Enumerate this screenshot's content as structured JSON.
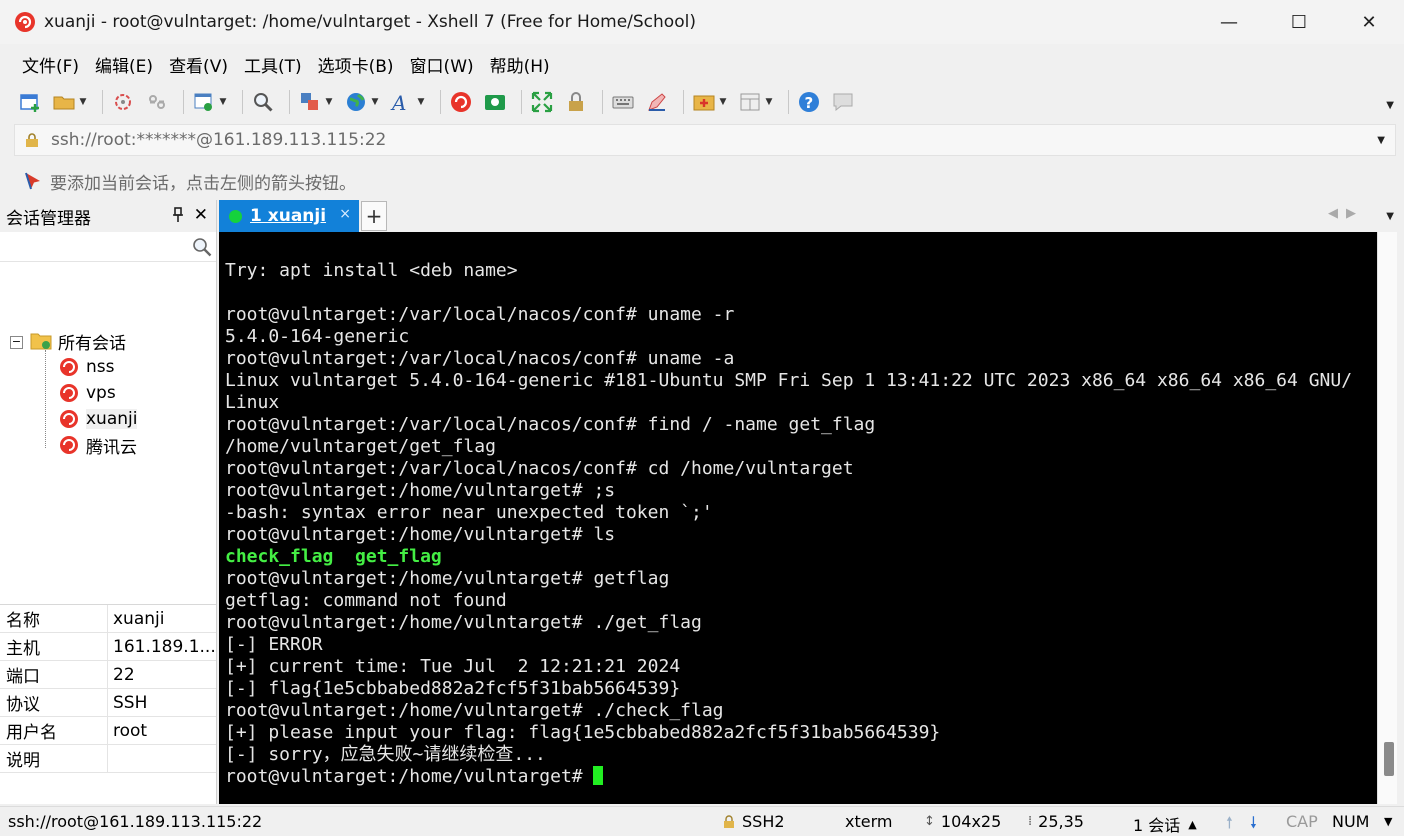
{
  "window": {
    "title": "xuanji - root@vulntarget: /home/vulntarget - Xshell 7 (Free for Home/School)",
    "minimize": "—",
    "maximize": "☐",
    "close": "✕"
  },
  "menu": [
    "文件(F)",
    "编辑(E)",
    "查看(V)",
    "工具(T)",
    "选项卡(B)",
    "窗口(W)",
    "帮助(H)"
  ],
  "toolbar": {
    "icons": [
      "new-session-icon",
      "open-folder-icon",
      "reconnect-icon",
      "disconnect-icon",
      "properties-icon",
      "find-icon",
      "transfer-icon",
      "globe-icon",
      "font-icon",
      "xshell-icon",
      "xftp-icon",
      "fullscreen-icon",
      "lock-icon",
      "keyboard-icon",
      "highlight-icon",
      "add-tab-icon",
      "layout-icon",
      "help-icon",
      "chat-icon"
    ]
  },
  "address": {
    "value": "ssh://root:*******@161.189.113.115:22"
  },
  "hint": {
    "text": "要添加当前会话，点击左侧的箭头按钮。"
  },
  "session_manager": {
    "title": "会话管理器",
    "pin": "📌",
    "close": "✕",
    "search_placeholder": "",
    "root_folder": "所有会话",
    "toggle": "−",
    "sessions": [
      "nss",
      "vps",
      "xuanji",
      "腾讯云"
    ],
    "selected": "xuanji",
    "properties": [
      {
        "key": "名称",
        "value": "xuanji"
      },
      {
        "key": "主机",
        "value": "161.189.1..."
      },
      {
        "key": "端口",
        "value": "22"
      },
      {
        "key": "协议",
        "value": "SSH"
      },
      {
        "key": "用户名",
        "value": "root"
      },
      {
        "key": "说明",
        "value": ""
      }
    ]
  },
  "tabs": {
    "active_label": "1 xuanji",
    "close": "×",
    "add": "+",
    "nav": "◀▶"
  },
  "terminal": {
    "lines": [
      {
        "text": "Try: apt install <deb name>",
        "style": "normal"
      },
      {
        "text": "",
        "style": "normal"
      },
      {
        "text": "root@vulntarget:/var/local/nacos/conf# uname -r",
        "style": "normal"
      },
      {
        "text": "5.4.0-164-generic",
        "style": "normal"
      },
      {
        "text": "root@vulntarget:/var/local/nacos/conf# uname -a",
        "style": "normal"
      },
      {
        "text": "Linux vulntarget 5.4.0-164-generic #181-Ubuntu SMP Fri Sep 1 13:41:22 UTC 2023 x86_64 x86_64 x86_64 GNU/",
        "style": "normal"
      },
      {
        "text": "Linux",
        "style": "normal"
      },
      {
        "text": "root@vulntarget:/var/local/nacos/conf# find / -name get_flag",
        "style": "normal"
      },
      {
        "text": "/home/vulntarget/get_flag",
        "style": "normal"
      },
      {
        "text": "root@vulntarget:/var/local/nacos/conf# cd /home/vulntarget",
        "style": "normal"
      },
      {
        "text": "root@vulntarget:/home/vulntarget# ;s",
        "style": "normal"
      },
      {
        "text": "-bash: syntax error near unexpected token `;'",
        "style": "normal"
      },
      {
        "text": "root@vulntarget:/home/vulntarget# ls",
        "style": "normal"
      },
      {
        "text": "check_flag  get_flag",
        "style": "green"
      },
      {
        "text": "root@vulntarget:/home/vulntarget# getflag",
        "style": "normal"
      },
      {
        "text": "getflag: command not found",
        "style": "normal"
      },
      {
        "text": "root@vulntarget:/home/vulntarget# ./get_flag",
        "style": "normal"
      },
      {
        "text": "[-] ERROR",
        "style": "normal"
      },
      {
        "text": "[+] current time: Tue Jul  2 12:21:21 2024",
        "style": "normal"
      },
      {
        "text": "[-] flag{1e5cbbabed882a2fcf5f31bab5664539}",
        "style": "normal"
      },
      {
        "text": "root@vulntarget:/home/vulntarget# ./check_flag",
        "style": "normal"
      },
      {
        "text": "[+] please input your flag: flag{1e5cbbabed882a2fcf5f31bab5664539}",
        "style": "normal"
      },
      {
        "text": "[-] sorry，应急失败~请继续检查...",
        "style": "normal"
      },
      {
        "text": "root@vulntarget:/home/vulntarget# ",
        "style": "prompt"
      }
    ]
  },
  "status": {
    "connection": "ssh://root@161.189.113.115:22",
    "protocol": "SSH2",
    "terminal": "xterm",
    "size": "104x25",
    "position": "25,35",
    "sessions": "1 会话",
    "caps": "CAP",
    "num": "NUM"
  },
  "colors": {
    "tab_active": "#1281d9",
    "terminal_bg": "#000000",
    "terminal_fg": "#e6e6e6",
    "ls_output": "#44ee44",
    "cursor": "#22ee22"
  }
}
